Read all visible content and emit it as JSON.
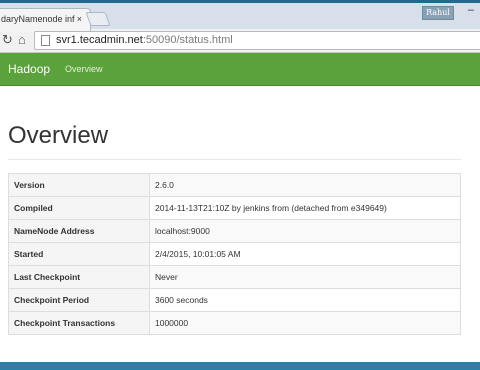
{
  "browser": {
    "tab_title": "daryNamenode info",
    "tab_close": "×",
    "user_badge": "Rahul",
    "minimize": "–",
    "url_host": "svr1.tecadmin.net",
    "url_rest": ":50090/status.html"
  },
  "navbar": {
    "brand": "Hadoop",
    "links": [
      "Overview"
    ]
  },
  "page": {
    "title": "Overview"
  },
  "info_table": [
    {
      "key": "Version",
      "value": "2.6.0"
    },
    {
      "key": "Compiled",
      "value": "2014-11-13T21:10Z by jenkins from (detached from e349649)"
    },
    {
      "key": "NameNode Address",
      "value": "localhost:9000"
    },
    {
      "key": "Started",
      "value": "2/4/2015, 10:01:05 AM"
    },
    {
      "key": "Last Checkpoint",
      "value": "Never"
    },
    {
      "key": "Checkpoint Period",
      "value": "3600 seconds"
    },
    {
      "key": "Checkpoint Transactions",
      "value": "1000000"
    }
  ],
  "colors": {
    "navbar": "#5ba13c",
    "window_frame": "#1f6b8f"
  }
}
